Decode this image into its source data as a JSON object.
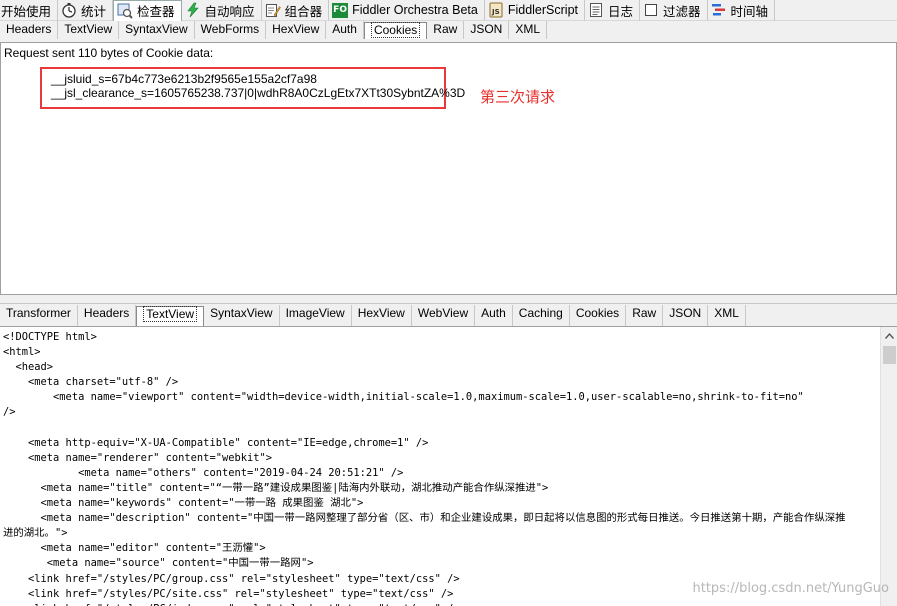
{
  "toolbar": {
    "items": [
      {
        "label": "开始使用",
        "icon": "none"
      },
      {
        "label": "统计",
        "icon": "stopwatch-icon"
      },
      {
        "label": "检查器",
        "icon": "inspect-icon",
        "active": true
      },
      {
        "label": "自动响应",
        "icon": "lightning-icon"
      },
      {
        "label": "组合器",
        "icon": "compose-icon"
      },
      {
        "label": "Fiddler Orchestra Beta",
        "icon": "fo-icon",
        "badge": "FO"
      },
      {
        "label": "FiddlerScript",
        "icon": "script-icon"
      },
      {
        "label": "日志",
        "icon": "log-icon"
      },
      {
        "label": "过滤器",
        "icon": "checkbox-icon"
      },
      {
        "label": "时间轴",
        "icon": "timeline-icon"
      }
    ]
  },
  "request_tabs": [
    "Headers",
    "TextView",
    "SyntaxView",
    "WebForms",
    "HexView",
    "Auth",
    "Cookies",
    "Raw",
    "JSON",
    "XML"
  ],
  "request_selected": "Cookies",
  "request": {
    "header": "Request sent 110 bytes of Cookie data:",
    "cookie_line_1": "__jsluid_s=67b4c773e6213b2f9565e155a2cf7a98",
    "cookie_line_2": "__jsl_clearance_s=1605765238.737|0|wdhR8A0CzLgEtx7XTt30SybntZA%3D",
    "annotation": "第三次请求"
  },
  "response_tabs": [
    "Transformer",
    "Headers",
    "TextView",
    "SyntaxView",
    "ImageView",
    "HexView",
    "WebView",
    "Auth",
    "Caching",
    "Cookies",
    "Raw",
    "JSON",
    "XML"
  ],
  "response_selected": "TextView",
  "response_lines": [
    "<!DOCTYPE html>",
    "<html>",
    "  <head>",
    "    <meta charset=\"utf-8\" />",
    "        <meta name=\"viewport\" content=\"width=device-width,initial-scale=1.0,maximum-scale=1.0,user-scalable=no,shrink-to-fit=no\"",
    "/>",
    "",
    "    <meta http-equiv=\"X-UA-Compatible\" content=\"IE=edge,chrome=1\" />",
    "    <meta name=\"renderer\" content=\"webkit\">",
    "            <meta name=\"others\" content=\"2019-04-24 20:51:21\" />",
    "      <meta name=\"title\" content=\"“一带一路”建设成果图鉴|陆海内外联动，湖北推动产能合作纵深推进\">",
    "      <meta name=\"keywords\" content=\"一带一路 成果图鉴 湖北\">",
    "      <meta name=\"description\" content=\"中国一带一路网整理了部分省（区、市）和企业建设成果，即日起将以信息图的形式每日推送。今日推送第十期，产能合作纵深推",
    "进的湖北。\">",
    "      <meta name=\"editor\" content=\"王沥懽\">",
    "       <meta name=\"source\" content=\"中国一带一路网\">",
    "    <link href=\"/styles/PC/group.css\" rel=\"stylesheet\" type=\"text/css\" />",
    "    <link href=\"/styles/PC/site.css\" rel=\"stylesheet\" type=\"text/css\" />",
    "    <link href=\"/styles/PC/index.css\" rel=\"stylesheet\" type=\"text/css\" />"
  ],
  "watermark": "https://blog.csdn.net/YungGuo",
  "colors": {
    "annotation": "#e8302b",
    "redbox": "#e83a3a",
    "fo_badge": "#1d8a3a"
  }
}
